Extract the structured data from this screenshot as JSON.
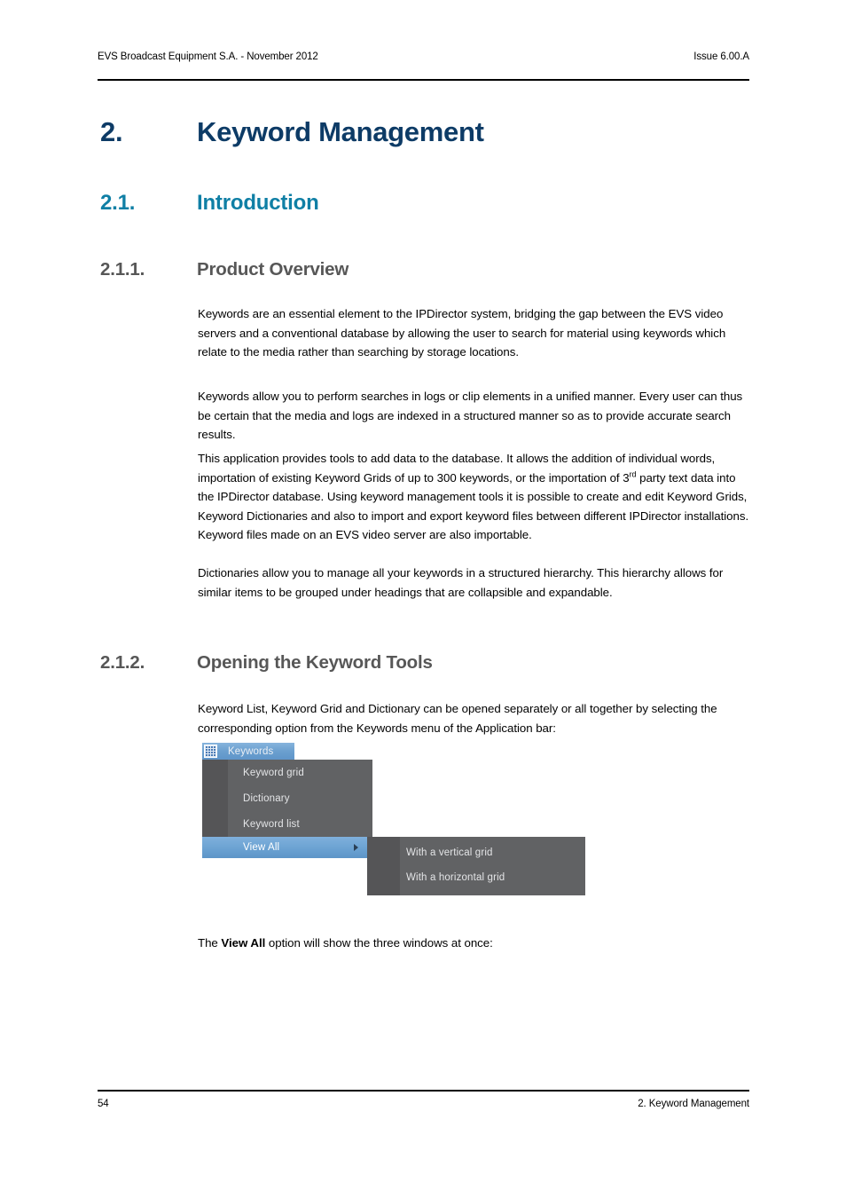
{
  "header": {
    "left": "EVS Broadcast Equipment S.A.  - November 2012",
    "right": "Issue 6.00.A"
  },
  "headings": {
    "h1_number": "2.",
    "h1_title": "Keyword Management",
    "h2_number": "2.1.",
    "h2_title": "Introduction",
    "h3a_number": "2.1.1.",
    "h3a_title": "Product Overview",
    "h3b_number": "2.1.2.",
    "h3b_title": "Opening the Keyword Tools"
  },
  "body": {
    "p1": "Keywords are an essential element to the IPDirector system, bridging the gap between the EVS video servers and a conventional database by allowing the user to search for material using keywords which relate to the media rather than searching by storage locations.",
    "p2": "Keywords allow you to perform searches in logs or clip elements in a unified manner. Every user can thus be certain that the media and logs are indexed in a structured manner so as to provide accurate search results.",
    "p3_part1": "This application provides tools to add data to the database. It allows the addition of individual words, importation of existing Keyword Grids of up to 300 keywords, or the importation of 3",
    "p3_sup": "rd",
    "p3_part2": " party text data into the IPDirector database. Using keyword management tools it is possible to create and edit Keyword Grids, Keyword Dictionaries and also to import and export keyword files between different IPDirector installations. Keyword files made on an EVS video server are also importable.",
    "p4": "Dictionaries allow you to manage all your keywords in a structured hierarchy. This hierarchy allows for similar items to be grouped under headings that are collapsible and expandable.",
    "p5": "Keyword List, Keyword Grid and Dictionary can be opened separately or all together by selecting the corresponding option from the Keywords menu of the Application bar:",
    "p6_part1": "The ",
    "p6_bold": "View All",
    "p6_part2": " option will show the three windows at once:"
  },
  "menu_figure": {
    "title": "Keywords",
    "title_icon": "grid-icon",
    "items": [
      {
        "label": "Keyword grid",
        "highlighted": false,
        "has_submenu": false
      },
      {
        "label": "Dictionary",
        "highlighted": false,
        "has_submenu": false
      },
      {
        "label": "Keyword list",
        "highlighted": false,
        "has_submenu": false
      },
      {
        "label": "View All",
        "highlighted": true,
        "has_submenu": true
      }
    ],
    "submenu_items": [
      {
        "label": "With a vertical grid"
      },
      {
        "label": "With a horizontal grid"
      }
    ],
    "colors": {
      "panel": "#616264",
      "gutter": "#555557",
      "highlight": "#6ba2d2",
      "titlebar": "#6b9fcf",
      "text": "#e4e5e7"
    }
  },
  "footer": {
    "page_number": "54",
    "chapter": "2. Keyword Management"
  },
  "theme": {
    "h1_color": "#0d3b66",
    "h2_color": "#0f7fa5",
    "h3_color": "#575757"
  }
}
